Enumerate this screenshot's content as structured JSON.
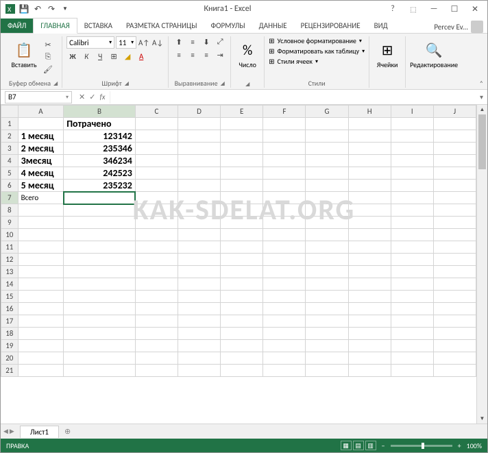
{
  "title": "Книга1 - Excel",
  "user": "Percev Ev...",
  "tabs": {
    "file": "ФАЙЛ",
    "home": "ГЛАВНАЯ",
    "insert": "ВСТАВКА",
    "pagelayout": "РАЗМЕТКА СТРАНИЦЫ",
    "formulas": "ФОРМУЛЫ",
    "data": "ДАННЫЕ",
    "review": "РЕЦЕНЗИРОВАНИЕ",
    "view": "ВИД"
  },
  "ribbon": {
    "paste": "Вставить",
    "clipboard": "Буфер обмена",
    "font_name": "Calibri",
    "font_size": "11",
    "font": "Шрифт",
    "alignment": "Выравнивание",
    "number": "Число",
    "cond_format": "Условное форматирование",
    "format_table": "Форматировать как таблицу",
    "cell_styles": "Стили ячеек",
    "styles": "Стили",
    "cells": "Ячейки",
    "editing": "Редактирование"
  },
  "namebox": "B7",
  "sheet": "Лист1",
  "status": "ПРАВКА",
  "zoom": "100%",
  "watermark": "KAK-SDELAT.ORG",
  "columns": [
    "A",
    "B",
    "C",
    "D",
    "E",
    "F",
    "G",
    "H",
    "I",
    "J"
  ],
  "rows": [
    1,
    2,
    3,
    4,
    5,
    6,
    7,
    8,
    9,
    10,
    11,
    12,
    13,
    14,
    15,
    16,
    17,
    18,
    19,
    20,
    21
  ],
  "chart_data": {
    "type": "table",
    "cells": {
      "B1": {
        "v": "Потрачено",
        "bold": true,
        "align": "left"
      },
      "A2": {
        "v": "1 месяц",
        "bold": true,
        "align": "left"
      },
      "B2": {
        "v": "123142",
        "bold": true,
        "align": "right"
      },
      "A3": {
        "v": "2 месяц",
        "bold": true,
        "align": "left"
      },
      "B3": {
        "v": "235346",
        "bold": true,
        "align": "right"
      },
      "A4": {
        "v": "3месяц",
        "bold": true,
        "align": "left"
      },
      "B4": {
        "v": "346234",
        "bold": true,
        "align": "right"
      },
      "A5": {
        "v": "4 месяц",
        "bold": true,
        "align": "left"
      },
      "B5": {
        "v": "242523",
        "bold": true,
        "align": "right"
      },
      "A6": {
        "v": "5 месяц",
        "bold": true,
        "align": "left"
      },
      "B6": {
        "v": "235232",
        "bold": true,
        "align": "right"
      },
      "A7": {
        "v": "Всего",
        "bold": false,
        "align": "left"
      }
    },
    "selected": "B7"
  }
}
